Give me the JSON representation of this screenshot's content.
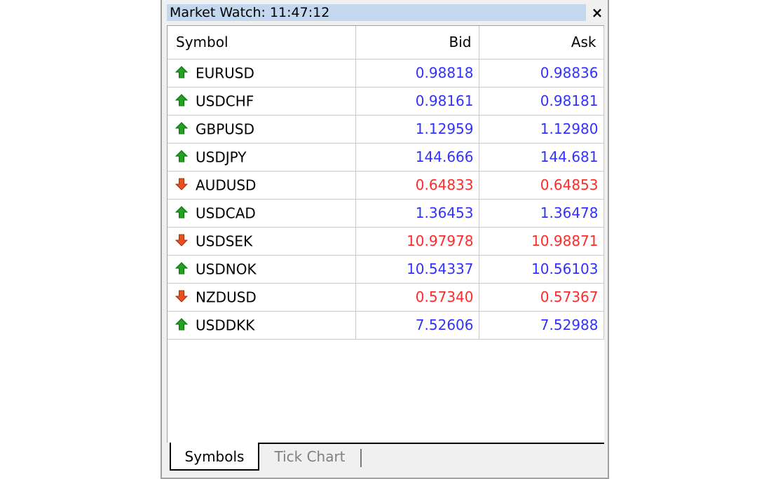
{
  "window": {
    "title": "Market Watch: 11:47:12",
    "close_glyph": "×"
  },
  "table": {
    "columns": [
      "Symbol",
      "Bid",
      "Ask"
    ],
    "rows": [
      {
        "symbol": "EURUSD",
        "bid": "0.98818",
        "ask": "0.98836",
        "direction": "up"
      },
      {
        "symbol": "USDCHF",
        "bid": "0.98161",
        "ask": "0.98181",
        "direction": "up"
      },
      {
        "symbol": "GBPUSD",
        "bid": "1.12959",
        "ask": "1.12980",
        "direction": "up"
      },
      {
        "symbol": "USDJPY",
        "bid": "144.666",
        "ask": "144.681",
        "direction": "up"
      },
      {
        "symbol": "AUDUSD",
        "bid": "0.64833",
        "ask": "0.64853",
        "direction": "down"
      },
      {
        "symbol": "USDCAD",
        "bid": "1.36453",
        "ask": "1.36478",
        "direction": "up"
      },
      {
        "symbol": "USDSEK",
        "bid": "10.97978",
        "ask": "10.98871",
        "direction": "down"
      },
      {
        "symbol": "USDNOK",
        "bid": "10.54337",
        "ask": "10.56103",
        "direction": "up"
      },
      {
        "symbol": "NZDUSD",
        "bid": "0.57340",
        "ask": "0.57367",
        "direction": "down"
      },
      {
        "symbol": "USDDKK",
        "bid": "7.52606",
        "ask": "7.52988",
        "direction": "up"
      }
    ]
  },
  "tabs": [
    {
      "label": "Symbols",
      "active": true
    },
    {
      "label": "Tick Chart",
      "active": false
    }
  ],
  "colors": {
    "up_text": "#3232ff",
    "down_text": "#ff2a2a",
    "up_icon": "#22a022",
    "down_icon": "#e8501e",
    "title_bg": "#c3d7ee"
  },
  "icons": {
    "up": "arrow-up-icon",
    "down": "arrow-down-icon"
  }
}
